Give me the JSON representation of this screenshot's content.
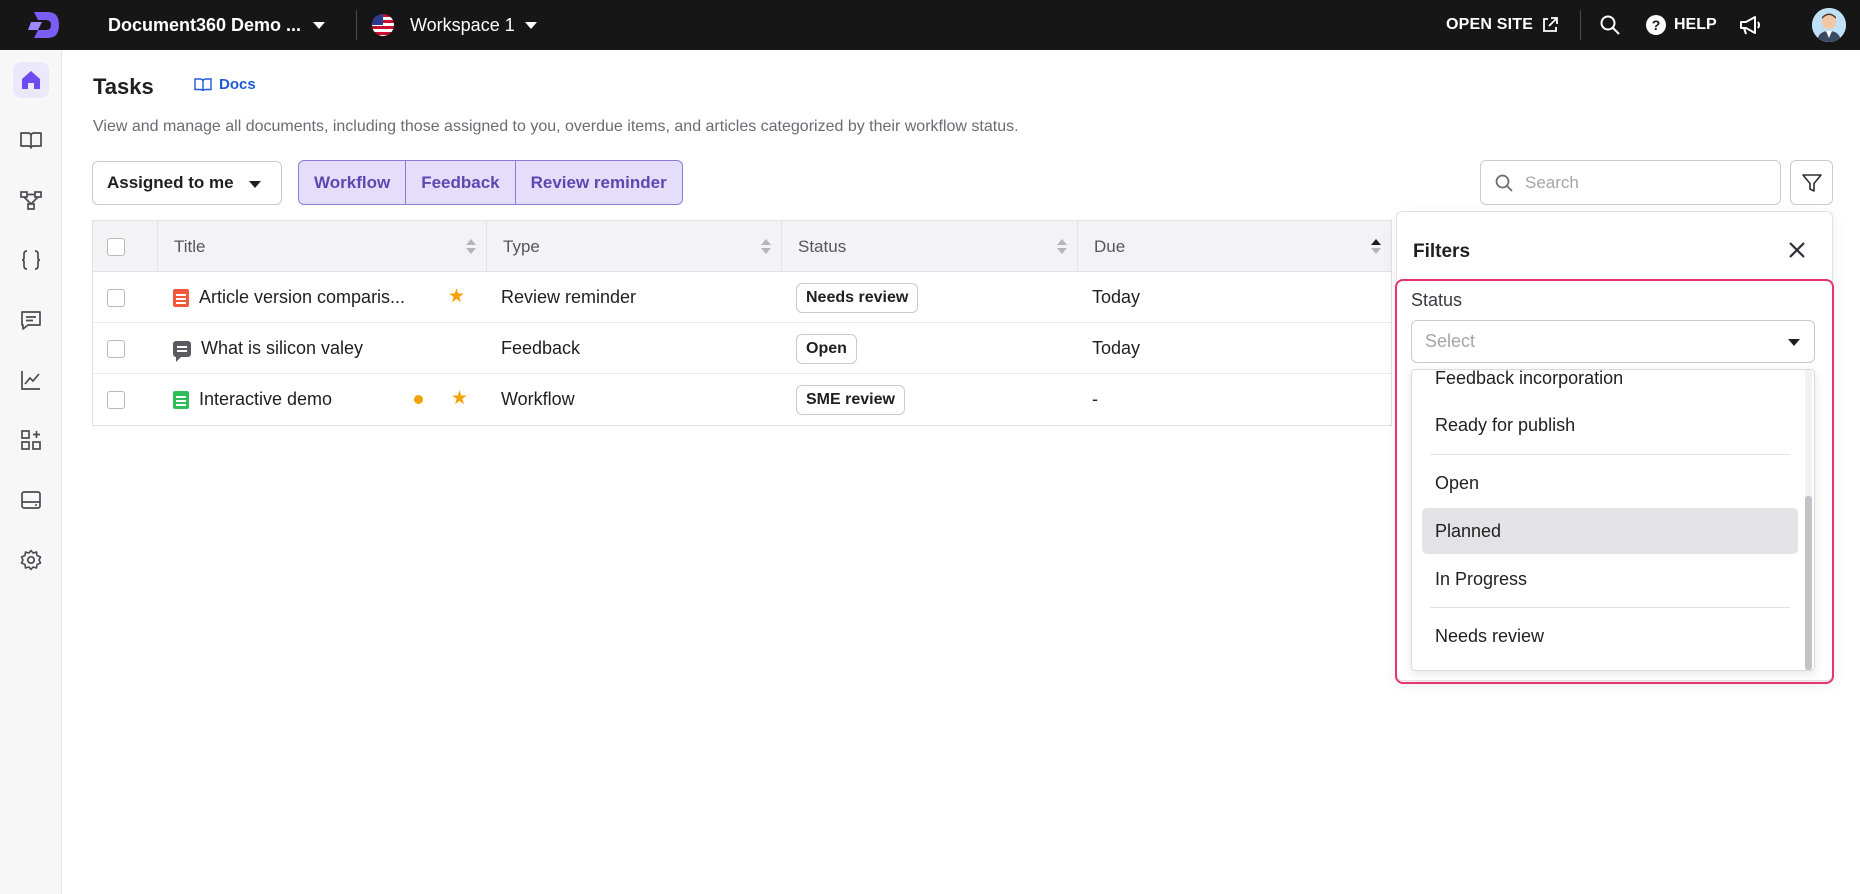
{
  "topbar": {
    "project_name": "Document360 Demo ...",
    "workspace_name": "Workspace 1",
    "open_site_label": "OPEN SITE",
    "help_label": "HELP"
  },
  "sidebar": {
    "items": [
      {
        "icon": "home-icon",
        "active": true
      },
      {
        "icon": "book-icon",
        "active": false
      },
      {
        "icon": "hierarchy-icon",
        "active": false
      },
      {
        "icon": "curly-braces-icon",
        "active": false
      },
      {
        "icon": "comment-icon",
        "active": false
      },
      {
        "icon": "analytics-icon",
        "active": false
      },
      {
        "icon": "apps-icon",
        "active": false
      },
      {
        "icon": "drive-icon",
        "active": false
      },
      {
        "icon": "gear-icon",
        "active": false
      }
    ]
  },
  "header": {
    "title": "Tasks",
    "docs_link": "Docs",
    "description": "View and manage all documents, including those assigned to you, overdue items, and articles categorized by their workflow status."
  },
  "toolbar": {
    "assigned_label": "Assigned to me",
    "segments": [
      "Workflow",
      "Feedback",
      "Review reminder"
    ],
    "search_placeholder": "Search"
  },
  "table": {
    "columns": [
      "Title",
      "Type",
      "Status",
      "Due"
    ],
    "rows": [
      {
        "title": "Article version comparis...",
        "type": "Review reminder",
        "status": "Needs review",
        "due": "Today",
        "starred": true,
        "dot": false,
        "icon": "article-icon"
      },
      {
        "title": "What is silicon valey",
        "type": "Feedback",
        "status": "Open",
        "due": "Today",
        "starred": false,
        "dot": false,
        "icon": "feedback-icon"
      },
      {
        "title": "Interactive demo",
        "type": "Workflow",
        "status": "SME review",
        "due": "-",
        "starred": true,
        "dot": true,
        "icon": "article-icon"
      }
    ]
  },
  "filters": {
    "title": "Filters",
    "status_label": "Status",
    "select_placeholder": "Select",
    "options": [
      "Feedback incorporation",
      "Ready for publish",
      "Open",
      "Planned",
      "In Progress",
      "Needs review"
    ],
    "hovered_option": "Planned"
  },
  "colors": {
    "accent": "#6c4cf1",
    "highlight": "#e8336f",
    "star": "#f5a100"
  }
}
